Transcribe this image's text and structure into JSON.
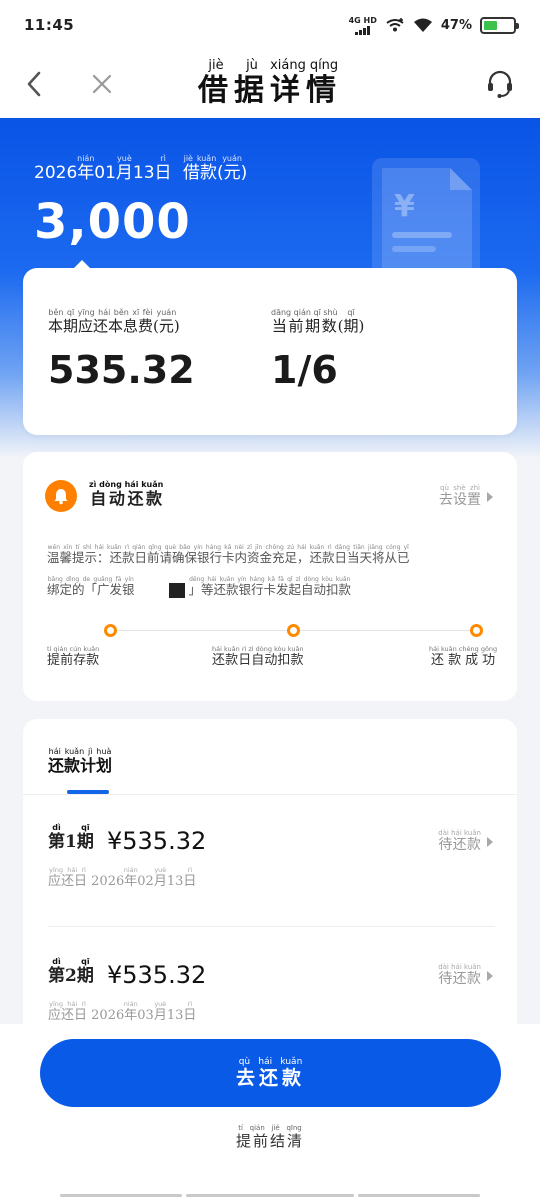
{
  "status_bar": {
    "time": "11:45",
    "network": "4G HD",
    "battery_percent": "47%",
    "battery_level": 0.47
  },
  "header": {
    "title_chars": [
      "借",
      "据",
      "详",
      "情"
    ],
    "title_pinyin": [
      "jiè",
      "jù",
      "xiáng",
      "qíng"
    ],
    "back_icon": "back-arrow-icon",
    "close_icon": "close-icon",
    "service_icon": "headset-icon"
  },
  "hero": {
    "year": "2026",
    "year_unit": "年",
    "year_unit_pinyin": "nián",
    "month": "01",
    "month_unit": "月",
    "month_unit_pinyin": "yuè",
    "day": "13",
    "day_unit": "日",
    "day_unit_pinyin": "rì",
    "loan_label": "借款",
    "loan_pinyin": "jiè kuǎn",
    "unit": "(元)",
    "unit_pinyin": "yuán",
    "amount": "3,000"
  },
  "summary": {
    "left_label": "本期应还本息费",
    "left_label_pinyin": "běn qī yīng hái běn xī fèi",
    "left_unit": "(元)",
    "left_unit_pinyin": "yuán",
    "left_value": "535.32",
    "right_label": "当前期数",
    "right_label_pinyin": "dāng qián qī shù",
    "right_unit": "(期)",
    "right_unit_pinyin": "qī",
    "right_value": "1/6"
  },
  "autopay": {
    "title": "自动还款",
    "title_pinyin": "zì dòng hái kuǎn",
    "setting_label": "去设置",
    "setting_pinyin": "qù shè zhì",
    "tip_line1": "温馨提示：还款日前请确保银行卡内资金充足，还款日当天将从已",
    "tip_line1_pinyin": "wēn xīn tí shì hái kuǎn rì qián qǐng què bǎo yín háng kǎ nèi zī jīn chōng zú hái kuǎn rì dāng tiān jiāng cóng yǐ",
    "tip_line2_a": "绑定的「广发银",
    "tip_line2_a_pinyin": "bǎng dìng de guǎng fā yín",
    "tip_line2_b": "」等还款银行卡发起自动扣款",
    "tip_line2_b_pinyin": "děng hái kuǎn yín háng kǎ fā qǐ zì dòng kòu kuǎn",
    "steps": [
      {
        "label": "提前存款",
        "pinyin": "tí qián cún kuǎn"
      },
      {
        "label": "还款日自动扣款",
        "pinyin": "hái kuǎn rì zì dòng kòu kuǎn"
      },
      {
        "label": "还款成功",
        "pinyin": "hái kuǎn chéng gōng"
      }
    ],
    "accent_color": "#ff7f00"
  },
  "plan": {
    "tab_label": "还款计划",
    "tab_pinyin": "hái kuǎn jì huà",
    "items": [
      {
        "period_prefix": "第",
        "period_prefix_pinyin": "dì",
        "period_num": "1",
        "period_suffix": "期",
        "period_suffix_pinyin": "qī",
        "amount": "¥535.32",
        "due_label": "应还日",
        "due_label_pinyin": "yīng hái rì",
        "due_year": "2026",
        "due_month": "02",
        "due_day": "13",
        "status": "待还款",
        "status_pinyin": "dài hái kuǎn"
      },
      {
        "period_prefix": "第",
        "period_prefix_pinyin": "dì",
        "period_num": "2",
        "period_suffix": "期",
        "period_suffix_pinyin": "qī",
        "amount": "¥535.32",
        "due_label": "应还日",
        "due_label_pinyin": "yīng hái rì",
        "due_year": "2026",
        "due_month": "03",
        "due_day": "13",
        "status": "待还款",
        "status_pinyin": "dài hái kuǎn"
      }
    ],
    "date_units": {
      "year": "年",
      "year_pinyin": "nián",
      "month": "月",
      "month_pinyin": "yuè",
      "day": "日",
      "day_pinyin": "rì"
    }
  },
  "bottom": {
    "pay_label": "去还款",
    "pay_pinyin": "qù hái kuǎn",
    "settle_label": "提前结清",
    "settle_pinyin": "tí qián jié qīng"
  },
  "colors": {
    "brand_blue": "#0a5ae8",
    "accent_orange": "#ff8a00"
  }
}
